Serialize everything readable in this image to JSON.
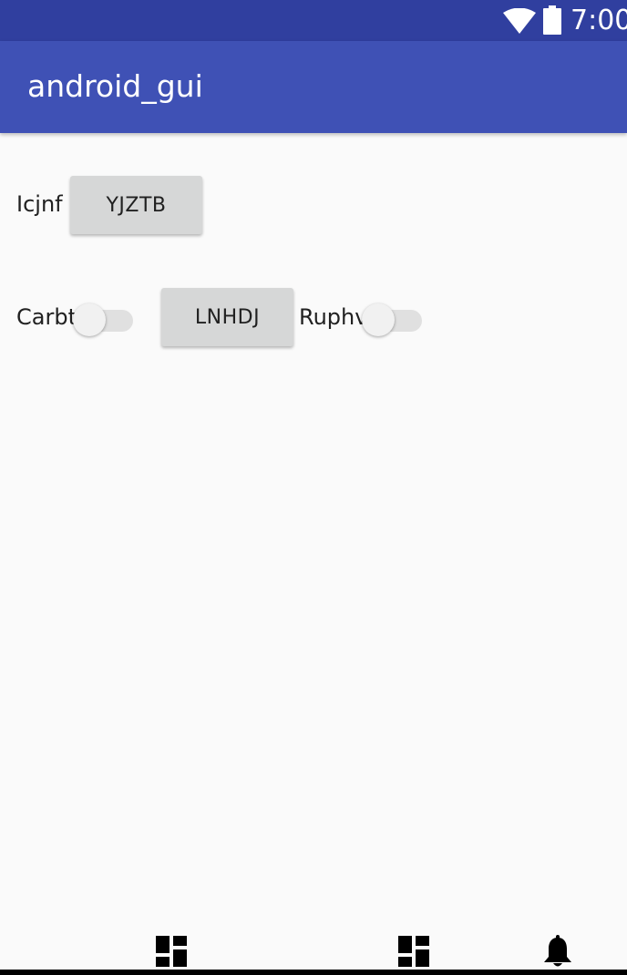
{
  "status_bar": {
    "time": "7:00",
    "icons": [
      "wifi-icon",
      "battery-icon"
    ],
    "background": "#303f9f"
  },
  "app_bar": {
    "title": "android_gui",
    "background": "#3f51b5"
  },
  "row1": {
    "label": "Icjnf",
    "button_label": "YJZTB"
  },
  "row2": {
    "switch1_label": "Carbt",
    "switch1_checked": false,
    "button_label": "LNHDJ",
    "switch2_label": "Ruphv",
    "switch2_checked": false
  },
  "bottom_icons": [
    "dashboard-icon",
    "dashboard-icon",
    "bell-icon"
  ],
  "colors": {
    "background": "#fafafa",
    "button": "#d6d7d7",
    "text": "#212121"
  }
}
